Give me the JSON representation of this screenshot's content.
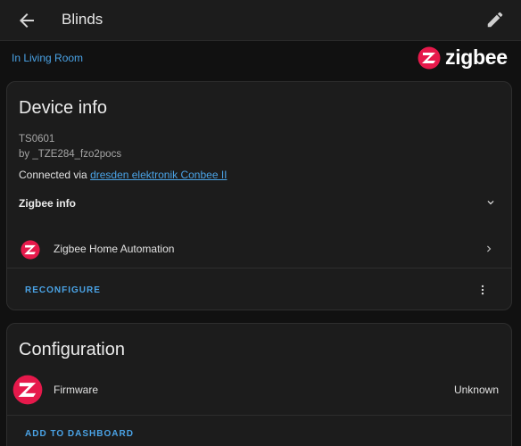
{
  "header": {
    "title": "Blinds"
  },
  "area_link": "In Living Room",
  "brand": {
    "name": "zigbee",
    "color": "#e6194b"
  },
  "device_info": {
    "title": "Device info",
    "model": "TS0601",
    "manufacturer": "by _TZE284_fzo2pocs",
    "connected_prefix": "Connected via ",
    "connected_link": "dresden elektronik Conbee II",
    "zigbee_info_label": "Zigbee info",
    "integration": "Zigbee Home Automation",
    "reconfigure_label": "RECONFIGURE"
  },
  "configuration": {
    "title": "Configuration",
    "firmware_label": "Firmware",
    "firmware_value": "Unknown",
    "add_label": "ADD TO DASHBOARD"
  },
  "icons": [
    "arrow-left-icon",
    "pencil-icon",
    "zigbee-logo-icon",
    "chevron-down-icon",
    "chevron-right-icon",
    "dots-vertical-icon"
  ],
  "colors": {
    "accent": "#4aa3e6",
    "background": "#111111",
    "card": "#1c1c1c"
  }
}
